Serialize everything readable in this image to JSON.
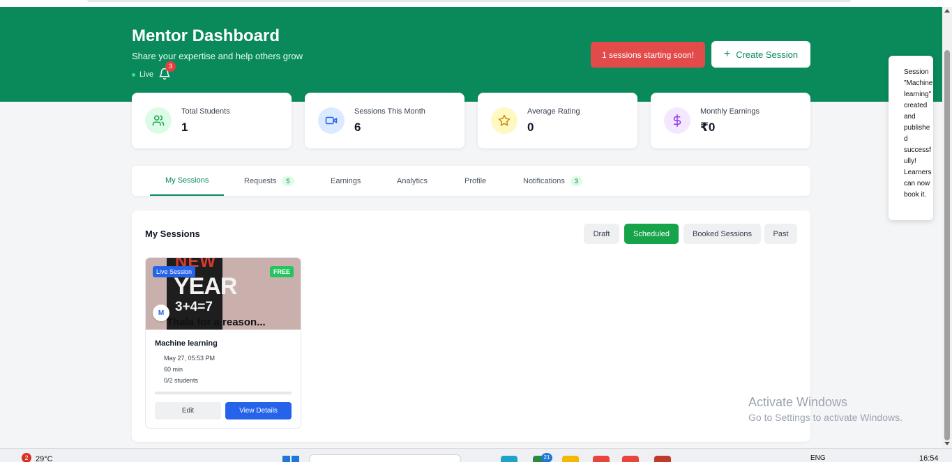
{
  "header": {
    "title": "Mentor Dashboard",
    "subtitle": "Share your expertise and help others grow",
    "live_label": "Live",
    "notification_count": "3",
    "alert_label": "1 sessions starting soon!",
    "create_label": "Create Session"
  },
  "stats": [
    {
      "label": "Total Students",
      "value": "1",
      "icon": "users-icon",
      "color": "#16a34a"
    },
    {
      "label": "Sessions This Month",
      "value": "6",
      "icon": "video-icon",
      "color": "#2563eb"
    },
    {
      "label": "Average Rating",
      "value": "0",
      "icon": "star-icon",
      "color": "#ca8a04"
    },
    {
      "label": "Monthly Earnings",
      "value": "₹0",
      "icon": "dollar-icon",
      "color": "#9333ea"
    }
  ],
  "tabs": [
    {
      "label": "My Sessions"
    },
    {
      "label": "Requests",
      "badge": "5"
    },
    {
      "label": "Earnings"
    },
    {
      "label": "Analytics"
    },
    {
      "label": "Profile"
    },
    {
      "label": "Notifications",
      "badge": "3"
    }
  ],
  "sessions_panel": {
    "title": "My Sessions",
    "filters": [
      "Draft",
      "Scheduled",
      "Booked Sessions",
      "Past"
    ],
    "active_filter": "Scheduled"
  },
  "session_card": {
    "type_tag": "Live Session",
    "price_tag": "FREE",
    "avatar_letter": "M",
    "thumbnail_text": {
      "line1": "NEW",
      "line2": "YEAR",
      "line3": "3+4=7",
      "line4": "Thala for a reason..."
    },
    "title": "Machine learning",
    "date": "May 27, 05:53 PM",
    "duration": "60 min",
    "students": "0/2 students",
    "booking_fill": 0,
    "edit_label": "Edit",
    "view_label": "View Details"
  },
  "toast": {
    "message": "Session \"Machine learning\" created and published successfully! Learners can now book it."
  },
  "watermark": {
    "line1": "Activate Windows",
    "line2": "Go to Settings to activate Windows."
  },
  "taskbar": {
    "weather_badge": "2",
    "temperature": "29°C",
    "app_badge": "21",
    "language": "ENG",
    "time": "16:54"
  }
}
